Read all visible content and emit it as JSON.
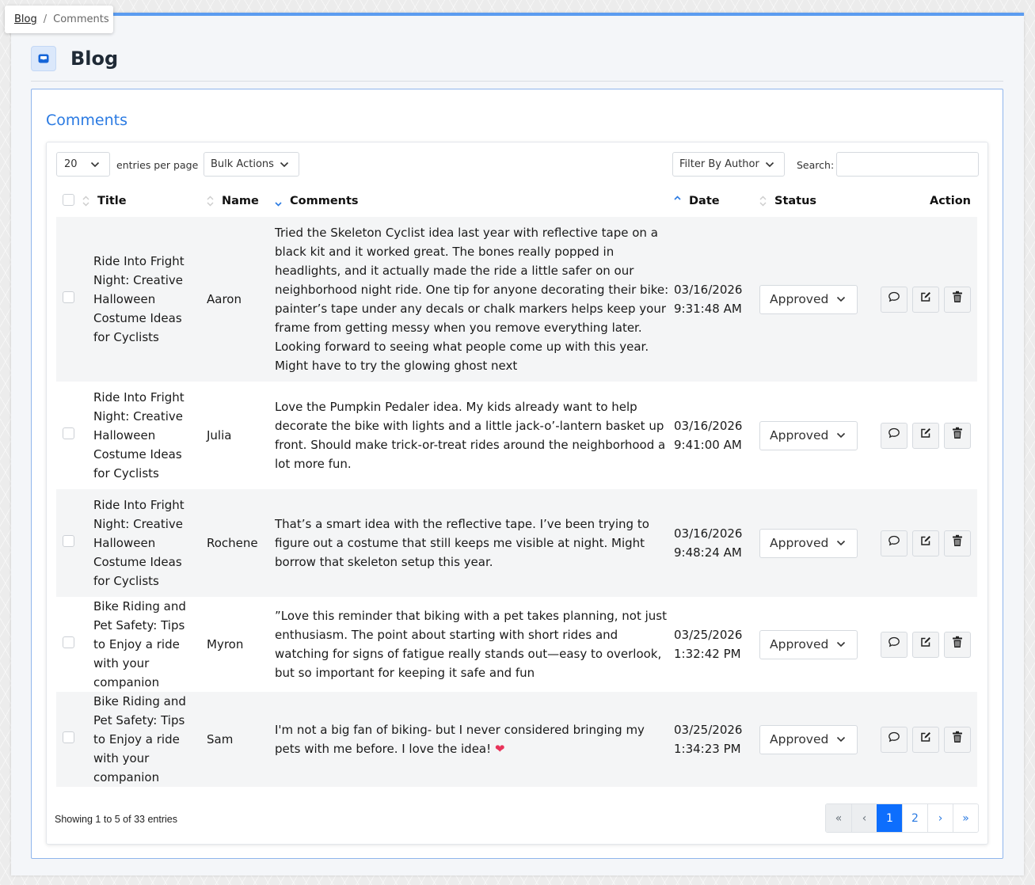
{
  "breadcrumb": {
    "link": "Blog",
    "separator": "/",
    "current": "Comments"
  },
  "header": {
    "title": "Blog",
    "icon": "inbox-icon"
  },
  "card": {
    "title": "Comments"
  },
  "toolbar": {
    "entries_value": "20",
    "entries_label": "entries per page",
    "bulk_actions": "Bulk Actions",
    "filter_author": "Filter By Author",
    "search_label": "Search:",
    "search_value": ""
  },
  "columns": {
    "title": "Title",
    "name": "Name",
    "comments": "Comments",
    "date": "Date",
    "status": "Status",
    "action": "Action"
  },
  "rows": [
    {
      "title": "Ride Into Fright Night: Creative Halloween Costume Ideas for Cyclists",
      "name": "Aaron",
      "comment": "Tried the Skeleton Cyclist idea last year with reflective tape on a black kit and it worked great. The bones really popped in headlights, and it actually made the ride a little safer on our neighborhood night ride. One tip for anyone decorating their bike: painter’s tape under any decals or chalk markers helps keep your frame from getting messy when you remove everything later. Looking forward to seeing what people come up with this year. Might have to try the glowing ghost next",
      "date": "03/16/2026",
      "time": "9:31:48 AM",
      "status": "Approved"
    },
    {
      "title": "Ride Into Fright Night: Creative Halloween Costume Ideas for Cyclists",
      "name": "Julia",
      "comment": "Love the Pumpkin Pedaler idea. My kids already want to help decorate the bike with lights and a little jack-o’-lantern basket up front. Should make trick-or-treat rides around the neighborhood a lot more fun.",
      "date": "03/16/2026",
      "time": "9:41:00 AM",
      "status": "Approved"
    },
    {
      "title": "Ride Into Fright Night: Creative Halloween Costume Ideas for Cyclists",
      "name": "Rochene",
      "comment": "That’s a smart idea with the reflective tape. I’ve been trying to figure out a costume that still keeps me visible at night. Might borrow that skeleton setup this year.",
      "date": "03/16/2026",
      "time": "9:48:24 AM",
      "status": "Approved"
    },
    {
      "title": "Bike Riding and Pet Safety: Tips to Enjoy a ride with your companion",
      "name": "Myron",
      "comment": "”Love this reminder that biking with a pet takes planning, not just enthusiasm. The point about starting with short rides and watching for signs of fatigue really stands out—easy to overlook, but so important for keeping it safe and fun",
      "date": "03/25/2026",
      "time": "1:32:42 PM",
      "status": "Approved"
    },
    {
      "title": "Bike Riding and Pet Safety: Tips to Enjoy a ride with your companion",
      "name": "Sam",
      "comment": "I'm not a big fan of biking- but I never considered bringing my pets with me before. I love the idea! ❤️",
      "date": "03/25/2026",
      "time": "1:34:23 PM",
      "status": "Approved"
    }
  ],
  "footer": {
    "info": "Showing 1 to 5 of 33 entries",
    "pages": [
      "«",
      "‹",
      "1",
      "2",
      "›",
      "»"
    ],
    "active_page": "1"
  },
  "colors": {
    "accent": "#2a7ae2",
    "active_page": "#0d6efd",
    "heart": "#e8335a"
  }
}
